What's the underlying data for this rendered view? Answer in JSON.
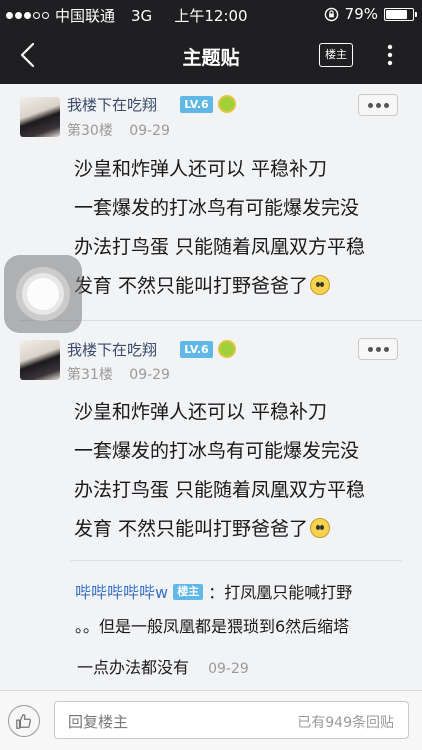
{
  "status_bar": {
    "carrier": "中国联通",
    "network": "3G",
    "time": "上午12:00",
    "battery_percent": "79%",
    "battery_level": 0.79
  },
  "nav": {
    "title": "主题贴",
    "louzhu_label": "楼主"
  },
  "posts": [
    {
      "username": "我楼下在吃翔",
      "level": "LV.6",
      "floor": "第30楼",
      "date": "09-29",
      "lines": [
        "沙皇和炸弹人还可以 平稳补刀",
        "一套爆发的打冰鸟有可能爆发完没",
        "办法打鸟蛋 只能随着凤凰双方平稳",
        "发育 不然只能叫打野爸爸了"
      ]
    },
    {
      "username": "我楼下在吃翔",
      "level": "LV.6",
      "floor": "第31楼",
      "date": "09-29",
      "lines": [
        "沙皇和炸弹人还可以 平稳补刀",
        "一套爆发的打冰鸟有可能爆发完没",
        "办法打鸟蛋 只能随着凤凰双方平稳",
        "发育 不然只能叫打野爸爸了"
      ],
      "reply": {
        "user": "哔哔哔哔哔w",
        "badge": "楼主",
        "line1": "：打凤凰只能喊打野",
        "line2": "。。但是一般凤凰都是猥琐到6然后缩塔",
        "line3": "一点办法都没有",
        "date": "09-29"
      }
    }
  ],
  "bottom": {
    "placeholder": "回复楼主",
    "reply_count": "已有949条回贴"
  },
  "colors": {
    "nav_bg": "#1f1f22",
    "level_badge": "#5fb8e8",
    "username": "#3a4a6b",
    "reply_user": "#3a74c8"
  }
}
